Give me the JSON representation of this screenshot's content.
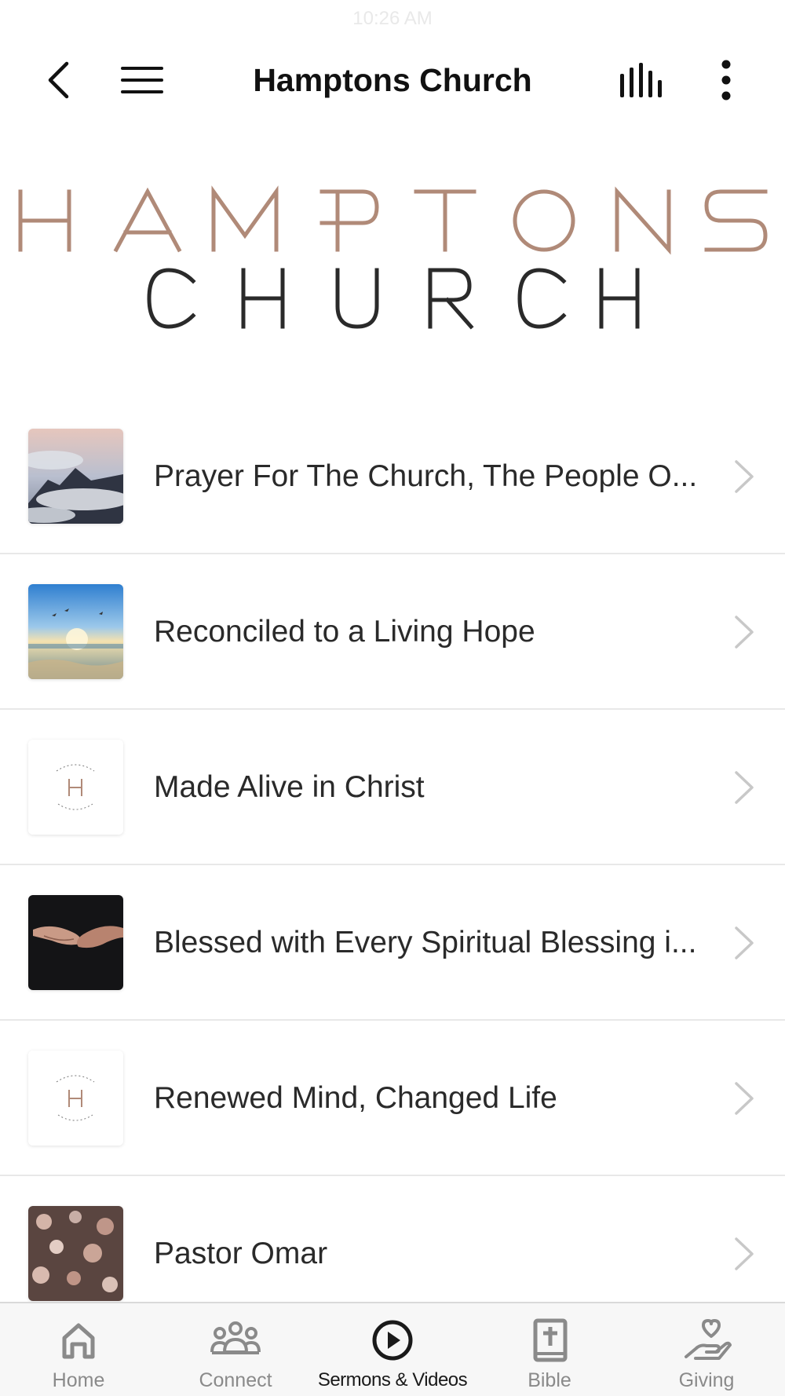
{
  "status_bar": {
    "time": "10:26 AM"
  },
  "header": {
    "title": "Hamptons Church",
    "back_icon": "chevron-left-icon",
    "menu_icon": "hamburger-icon",
    "audio_icon": "audio-bars-icon",
    "more_icon": "vertical-dots-icon"
  },
  "logo": {
    "line1": "HAMPTONS",
    "line2": "CHURCH",
    "line1_color": "#b08a78",
    "line2_color": "#2a2a2a"
  },
  "sermons": [
    {
      "title": "Prayer For The Church, The People O...",
      "thumbnail": "mountain-clouds"
    },
    {
      "title": "Reconciled to a Living Hope",
      "thumbnail": "ocean-sunrise"
    },
    {
      "title": "Made Alive in Christ",
      "thumbnail": "hamptons-logo"
    },
    {
      "title": "Blessed with Every Spiritual Blessing i...",
      "thumbnail": "open-hands"
    },
    {
      "title": "Renewed Mind, Changed Life",
      "thumbnail": "hamptons-logo"
    },
    {
      "title": "Pastor Omar",
      "thumbnail": "bokeh-hearts"
    }
  ],
  "tabs": [
    {
      "label": "Home",
      "icon": "home-icon",
      "active": false
    },
    {
      "label": "Connect",
      "icon": "people-icon",
      "active": false
    },
    {
      "label": "Sermons & Videos",
      "icon": "play-circle-icon",
      "active": true
    },
    {
      "label": "Bible",
      "icon": "bible-icon",
      "active": false
    },
    {
      "label": "Giving",
      "icon": "giving-hand-icon",
      "active": false
    }
  ],
  "colors": {
    "active_tab": "#1a1a1a",
    "inactive_tab": "#8a8a8a",
    "tab_bar_bg": "#f7f7f7",
    "divider": "#e8e8e8"
  }
}
